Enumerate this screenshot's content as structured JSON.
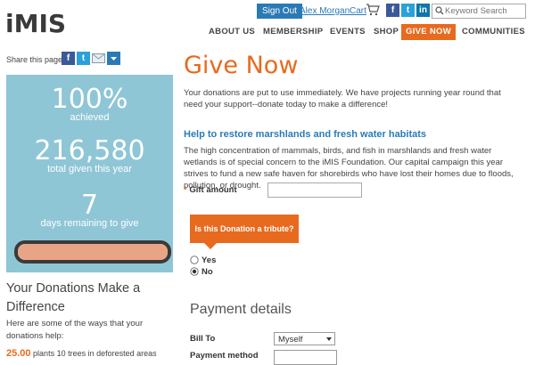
{
  "header": {
    "logo_text": "iMIS",
    "sign_out_label": "Sign Out",
    "user_name": "Alex Morgan",
    "cart_label": "Cart",
    "social": [
      "f",
      "t",
      "in"
    ],
    "search_placeholder": "Keyword Search"
  },
  "nav": {
    "items": [
      "ABOUT US",
      "MEMBERSHIP",
      "EVENTS",
      "SHOP",
      "GIVE NOW",
      "COMMUNITIES"
    ],
    "active": "GIVE NOW"
  },
  "sidebar": {
    "share_label": "Share this page",
    "stats": [
      {
        "value": "100%",
        "label": "achieved"
      },
      {
        "value": "216,580",
        "label": "total given this year"
      },
      {
        "value": "7",
        "label": "days remaining to give"
      }
    ],
    "progress_percent": 100,
    "donations_heading": "Your Donations Make a Difference",
    "donations_text": "Here are some of the ways that your donations help:",
    "cut_amount": "25.00",
    "cut_text": "plants 10 trees in deforested areas"
  },
  "main": {
    "title": "Give Now",
    "intro": "Your donations are put to use immediately. We have projects running year round that need your support--donate today to make a difference!",
    "section_heading": "Help to restore marshlands and fresh water habitats",
    "section_text": "The high concentration of mammals, birds, and fish in marshlands and fresh water wetlands is of special concern to the iMIS Foundation. Our capital campaign this year strives to fund a new safe haven for shorebirds who have lost their homes due to floods, pollution, or drought.",
    "gift_label": "Gift amount",
    "gift_value": "",
    "tribute_question": "Is this Donation a tribute?",
    "radio_yes": "Yes",
    "radio_no": "No",
    "radio_selected": "No",
    "payment_heading": "Payment details",
    "bill_to_label": "Bill To",
    "bill_to_value": "Myself",
    "payment_method_label": "Payment method"
  },
  "colors": {
    "accent": "#e86a1e",
    "link": "#2a7bb5",
    "panel": "#8fc6d6"
  }
}
